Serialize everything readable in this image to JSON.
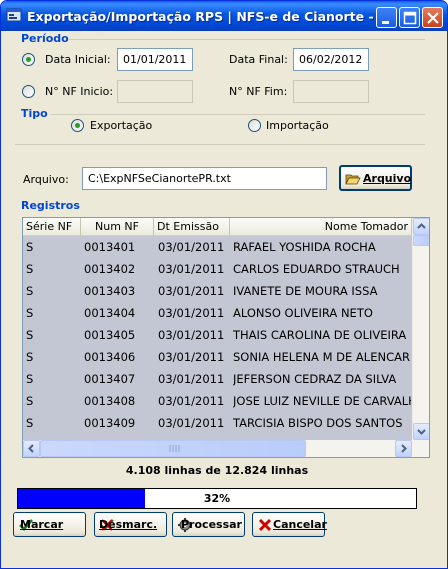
{
  "window": {
    "title": "Exportação/Importação RPS   |  NFS-e de Cianorte - PR"
  },
  "periodo": {
    "section_title": "Período",
    "data_inicial_label": "Data Inicial:",
    "data_inicial_value": "01/01/2011",
    "data_final_label": "Data Final:",
    "data_final_value": "06/02/2012",
    "nf_inicio_label": "N° NF Inicio:",
    "nf_inicio_value": "",
    "nf_fim_label": "N° NF Fim:",
    "nf_fim_value": "",
    "mode_selected": "data"
  },
  "tipo": {
    "section_title": "Tipo",
    "exportacao_label": "Exportação",
    "importacao_label": "Importação",
    "selected": "exportacao"
  },
  "arquivo": {
    "label": "Arquivo:",
    "value": "C:\\ExpNFSeCianortePR.txt",
    "button_label": "Arquivo",
    "button_icon": "folder-open-icon"
  },
  "registros": {
    "section_title": "Registros",
    "columns": [
      "Série NF",
      "Num NF",
      "Dt Emissão",
      "Nome Tomador"
    ],
    "rows": [
      [
        "S",
        "0013401",
        "03/01/2011",
        "RAFAEL YOSHIDA ROCHA"
      ],
      [
        "S",
        "0013402",
        "03/01/2011",
        "CARLOS EDUARDO STRAUCH"
      ],
      [
        "S",
        "0013403",
        "03/01/2011",
        "IVANETE DE MOURA ISSA"
      ],
      [
        "S",
        "0013404",
        "03/01/2011",
        "ALONSO OLIVEIRA NETO"
      ],
      [
        "S",
        "0013405",
        "03/01/2011",
        "THAIS CAROLINA DE OLIVEIRA"
      ],
      [
        "S",
        "0013406",
        "03/01/2011",
        "SONIA HELENA M DE ALENCAR"
      ],
      [
        "S",
        "0013407",
        "03/01/2011",
        "JEFERSON CEDRAZ DA SILVA"
      ],
      [
        "S",
        "0013408",
        "03/01/2011",
        "JOSE LUIZ NEVILLE DE CARVALHO"
      ],
      [
        "S",
        "0013409",
        "03/01/2011",
        "TARCISIA BISPO DOS SANTOS"
      ]
    ]
  },
  "status": {
    "text": "4.108 linhas de 12.824 linhas"
  },
  "progress": {
    "percent": 32,
    "label": "32%",
    "fill_color": "#0000ff"
  },
  "buttons": {
    "marcar": "Marcar",
    "desmarcar": "Desmarc.",
    "processar": "Processar",
    "cancelar": "Cancelar"
  },
  "colors": {
    "section_title": "#0046d5",
    "titlebar": "#0054e3"
  }
}
